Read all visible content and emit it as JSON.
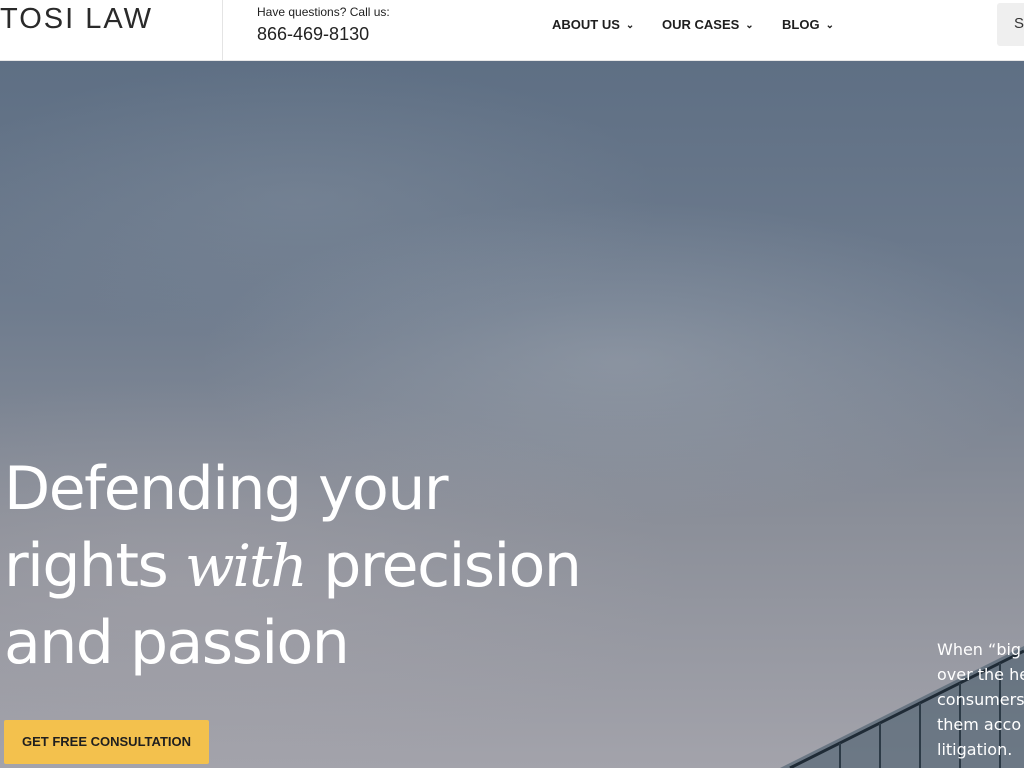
{
  "header": {
    "logo": "TOSI LAW",
    "call_label": "Have questions? Call us:",
    "phone": "866-469-8130",
    "nav": [
      {
        "label": "ABOUT US",
        "chevron": "chevron-down-icon"
      },
      {
        "label": "OUR CASES",
        "chevron": "chevron-down-icon"
      },
      {
        "label": "BLOG",
        "chevron": "chevron-down-icon"
      }
    ],
    "search_label": "S"
  },
  "hero": {
    "headline_line1": "Defending your",
    "headline_line2_a": "rights ",
    "headline_line2_em": "with",
    "headline_line2_b": " precision",
    "headline_line3": "and passion",
    "cta_label": "GET FREE CONSULTATION",
    "side_lines": [
      "When “big",
      "over the he",
      "consumers",
      "them acco",
      "litigation."
    ]
  },
  "colors": {
    "accent": "#f3c14d",
    "header_bg": "#ffffff",
    "hero_text": "#ffffff"
  }
}
